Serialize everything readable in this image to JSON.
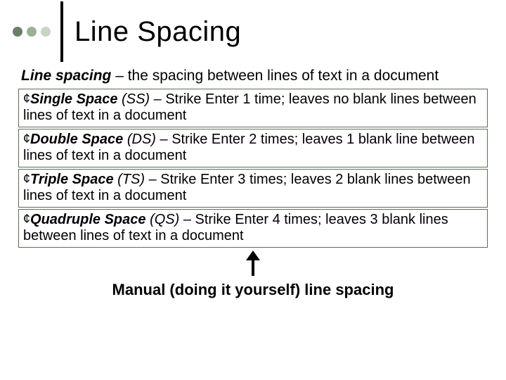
{
  "title": "Line Spacing",
  "definition": {
    "term": "Line spacing",
    "rest": " – the spacing between lines of text in a document"
  },
  "items": [
    {
      "term": "Single Space",
      "abbr": " (SS)",
      "rest": " – Strike Enter 1 time; leaves no blank lines between lines of text in a document"
    },
    {
      "term": "Double Space",
      "abbr": " (DS)",
      "rest": " – Strike Enter 2 times; leaves 1 blank line between lines of text in a document"
    },
    {
      "term": "Triple Space",
      "abbr": " (TS)",
      "rest": " – Strike Enter 3 times; leaves 2 blank lines between lines of text in a document"
    },
    {
      "term": "Quadruple Space",
      "abbr": " (QS)",
      "rest": " – Strike Enter 4 times; leaves 3 blank lines between lines of text in a document"
    }
  ],
  "footer": "Manual (doing it yourself) line spacing",
  "bullet": "¢"
}
